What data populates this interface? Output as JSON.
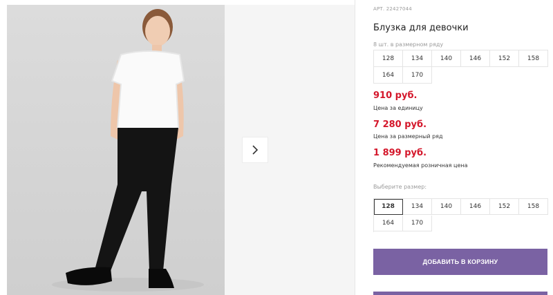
{
  "gallery": {
    "next_icon": "chevron-right-icon"
  },
  "product": {
    "article": "АРТ. 22427044",
    "title": "Блузка для девочки",
    "size_row_label": "8 шт. в размерном ряду",
    "size_row": [
      "128",
      "134",
      "140",
      "146",
      "152",
      "158",
      "164",
      "170"
    ],
    "prices": [
      {
        "value": "910 руб.",
        "label": "Цена за единицу"
      },
      {
        "value": "7 280 руб.",
        "label": "Цена за размерный ряд"
      },
      {
        "value": "1 899 руб.",
        "label": "Рекомендуемая розничная цена"
      }
    ],
    "choose_label": "Выберите размер:",
    "sizes": [
      "128",
      "134",
      "140",
      "146",
      "152",
      "158",
      "164",
      "170"
    ],
    "selected_size": "128",
    "cart_button": "ДОБАВИТЬ В КОРЗИНУ"
  },
  "colors": {
    "price": "#d4172b",
    "button": "#7a62a3"
  }
}
